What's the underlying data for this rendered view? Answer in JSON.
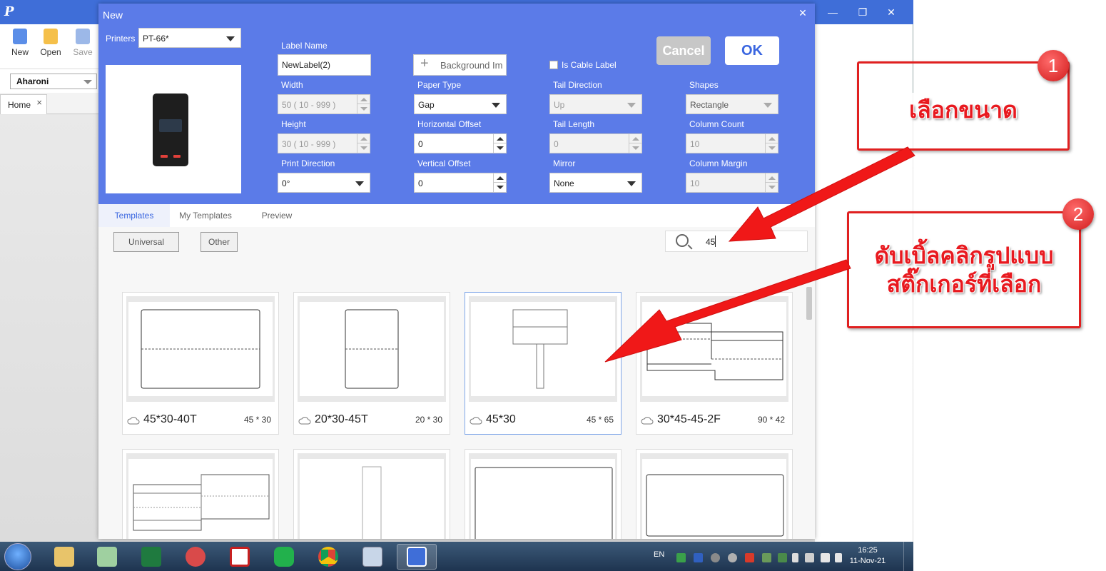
{
  "app": {
    "toolbar": {
      "new_label": "New",
      "open_label": "Open",
      "save_label": "Save"
    },
    "font": {
      "value": "Aharoni"
    },
    "home_tab": {
      "label": "Home",
      "close": "×"
    },
    "window_controls": {
      "minimize": "—",
      "restore": "❐",
      "close": "✕"
    }
  },
  "dialog": {
    "title": "New",
    "close": "✕",
    "printers": {
      "label": "Printers",
      "value": "PT-66*"
    },
    "label_name": {
      "label": "Label Name",
      "value": "NewLabel(2)"
    },
    "width": {
      "label": "Width",
      "value": "50 ( 10 - 999 )"
    },
    "height": {
      "label": "Height",
      "value": "30 ( 10 - 999 )"
    },
    "print_direction": {
      "label": "Print Direction",
      "value": "0°"
    },
    "background_image": {
      "label": "Background Im"
    },
    "paper_type": {
      "label": "Paper Type",
      "value": "Gap"
    },
    "horizontal_offset": {
      "label": "Horizontal Offset",
      "value": "0"
    },
    "vertical_offset": {
      "label": "Vertical Offset",
      "value": "0"
    },
    "cable_label": {
      "label": "Is Cable Label",
      "checked": false
    },
    "tail_direction": {
      "label": "Tail Direction",
      "value": "Up"
    },
    "tail_length": {
      "label": "Tail Length",
      "value": "0"
    },
    "mirror": {
      "label": "Mirror",
      "value": "None"
    },
    "shapes": {
      "label": "Shapes",
      "value": "Rectangle"
    },
    "column_count": {
      "label": "Column Count",
      "value": "10"
    },
    "column_margin": {
      "label": "Column Margin",
      "value": "10"
    },
    "cancel_label": "Cancel",
    "ok_label": "OK",
    "tabs": [
      {
        "label": "Templates",
        "active": true
      },
      {
        "label": "My Templates",
        "active": false
      },
      {
        "label": "Preview",
        "active": false
      }
    ],
    "categories": [
      "Universal",
      "Other"
    ],
    "search": {
      "value": "45"
    },
    "templates": [
      {
        "name": "45*30-40T",
        "size": "45 * 30",
        "selected": false
      },
      {
        "name": "20*30-45T",
        "size": "20 * 30",
        "selected": false
      },
      {
        "name": "45*30",
        "size": "45 * 65",
        "selected": true
      },
      {
        "name": "30*45-45-2F",
        "size": "90 * 42",
        "selected": false
      },
      {
        "name": "",
        "size": "",
        "selected": false
      },
      {
        "name": "",
        "size": "",
        "selected": false
      },
      {
        "name": "",
        "size": "",
        "selected": false
      },
      {
        "name": "",
        "size": "",
        "selected": false
      }
    ]
  },
  "taskbar": {
    "tray_lang": "EN",
    "time": "16:25",
    "date": "11-Nov-21"
  },
  "annotations": [
    {
      "number": "1",
      "text": "เลือกขนาด"
    },
    {
      "number": "2",
      "text_line1": "ดับเบิ้ลคลิกรูปแบบ",
      "text_line2": "สติ๊กเกอร์ที่เลือก"
    }
  ],
  "colors": {
    "title_bar": "#3f6ed8",
    "dialog_header": "#5b7be8",
    "accent": "#3a66e0",
    "annotation_red": "#e02020"
  }
}
